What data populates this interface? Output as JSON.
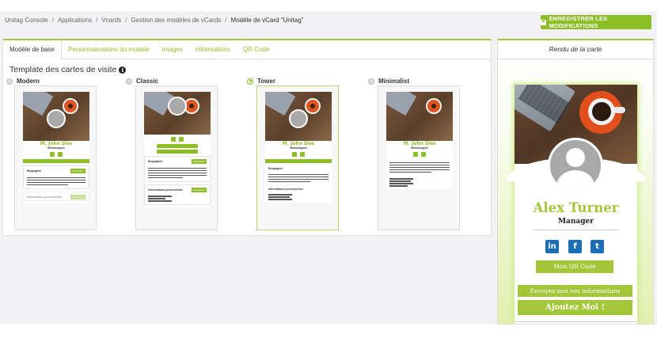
{
  "breadcrumb": {
    "items": [
      "Unitag Console",
      "Applications",
      "Vcards",
      "Gestion des modèles de vCards"
    ],
    "separator": "/",
    "current": "Modèle de vCard \"Unitag\""
  },
  "toolbar": {
    "save_label": "ENREGISTRER LES MODIFICATIONS",
    "save_icon": "floppy-disk-icon",
    "accent_color": "#8cbf26"
  },
  "tabs": [
    {
      "label": "Modèle de base",
      "active": true
    },
    {
      "label": "Personnalisations du modèle",
      "active": false
    },
    {
      "label": "Images",
      "active": false
    },
    {
      "label": "Informations",
      "active": false
    },
    {
      "label": "QR Code",
      "active": false
    }
  ],
  "template_section": {
    "title": "Template des cartes de visite",
    "info_icon": "info-icon",
    "options": [
      {
        "label": "Modern",
        "selected": false
      },
      {
        "label": "Classic",
        "selected": false
      },
      {
        "label": "Tower",
        "selected": true
      },
      {
        "label": "Minimalist",
        "selected": false
      }
    ]
  },
  "thumbnail": {
    "name": "M. John Doe",
    "subtitle": "Webdesigner",
    "section_bio": "Biographie",
    "section_info": "Informations personnelles",
    "tag": "Développer"
  },
  "preview": {
    "title": "Rendu de la carte",
    "person_name": "Alex Turner",
    "person_title": "Manager",
    "social": [
      {
        "icon": "linkedin-icon",
        "glyph": "in"
      },
      {
        "icon": "facebook-icon",
        "glyph": "f"
      },
      {
        "icon": "twitter-icon",
        "glyph": "t"
      }
    ],
    "qr_button": "Mon QR Code",
    "send_info_button": "Envoyez-moi vos informations",
    "add_button": "Ajoutez Moi !"
  }
}
